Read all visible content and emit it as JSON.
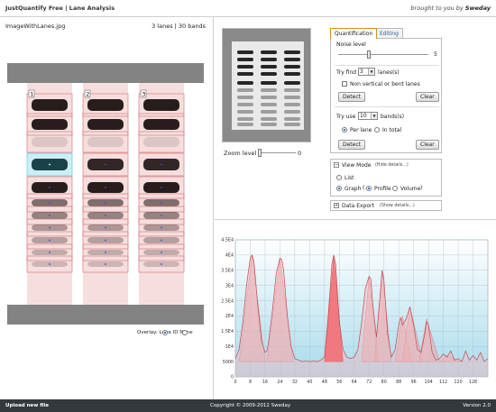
{
  "header": {
    "app_title": "JustQuantify Free  |  Lane Analysis",
    "brand_prefix": "brought to you by ",
    "brand_name": "Sweday"
  },
  "image_panel": {
    "file_name": "ImageWithLanes.jpg",
    "lane_count": "3 lanes | 30 bands",
    "lane_ids": [
      "1",
      "2",
      "3"
    ],
    "overlay": {
      "label": "Overlay:",
      "options": [
        {
          "label": "Lane ID",
          "selected": true
        },
        {
          "label": "None",
          "selected": false
        }
      ]
    }
  },
  "zoom": {
    "label": "Zoom level",
    "value": "0"
  },
  "tabs": [
    {
      "label": "Quantification",
      "active": true
    },
    {
      "label": "Editing",
      "active": false
    }
  ],
  "quant": {
    "noise_label": "Noise level",
    "noise_value": "5",
    "try_find_label": "Try find",
    "lanes_value": "3",
    "lanes_suffix": "lanes(s)",
    "non_vertical_label": "Non vertical or bent lanes",
    "detect_label": "Detect",
    "clear_label": "Clear",
    "try_use_label": "Try use",
    "bands_value": "10",
    "bands_suffix": "bands(s)",
    "per_lane_label": "Per lane",
    "in_total_label": "In total",
    "per_lane_selected": true
  },
  "view_mode": {
    "title": "View Mode",
    "hide_link": "(Hide details...)",
    "list_label": "List",
    "graph_label": "Graph",
    "profile_label": "Profile",
    "volume_label": "Volume",
    "graph_selected": true,
    "profile_selected": true
  },
  "data_export": {
    "title": "Data Export",
    "show_link": "(Show details...)"
  },
  "footer": {
    "upload_label": "Upload new file",
    "copyright": "Copyright © 2009-2012 Sweday",
    "version": "Version 2.0"
  },
  "chart_data": {
    "type": "area",
    "xlim": [
      0,
      136
    ],
    "ylim": [
      0,
      45000
    ],
    "y_ticks": [
      0,
      5000,
      10000,
      15000,
      20000,
      25000,
      30000,
      35000,
      40000,
      45000
    ],
    "y_tick_labels": [
      "0",
      "5000",
      "1E4",
      "1.5E4",
      "2E4",
      "2.5E4",
      "3E4",
      "3.5E4",
      "4E4",
      "4.5E4"
    ],
    "x_ticks": [
      0,
      8,
      16,
      24,
      32,
      40,
      48,
      56,
      64,
      72,
      80,
      88,
      96,
      104,
      112,
      120,
      128
    ],
    "x_tick_labels": [
      "0",
      "8",
      "16",
      "24",
      "32",
      "40",
      "48",
      "56",
      "64",
      "72",
      "80",
      "88",
      "96",
      "104",
      "112",
      "120",
      "128"
    ],
    "grid": true,
    "highlighted_peak_index": 2,
    "peaks": [
      {
        "x": [
          2,
          9,
          16
        ],
        "y": [
          5000,
          40000,
          5000
        ]
      },
      {
        "x": [
          17,
          24,
          31
        ],
        "y": [
          5000,
          39000,
          5000
        ]
      },
      {
        "x": [
          48,
          53,
          58
        ],
        "y": [
          5000,
          40000,
          5000
        ]
      },
      {
        "x": [
          68,
          72,
          77
        ],
        "y": [
          5000,
          33000,
          5000
        ]
      },
      {
        "x": [
          75,
          79,
          84
        ],
        "y": [
          5000,
          35000,
          5000
        ]
      },
      {
        "x": [
          86,
          90,
          95
        ],
        "y": [
          5000,
          20000,
          5000
        ]
      },
      {
        "x": [
          90,
          94,
          101
        ],
        "y": [
          5000,
          23000,
          5000
        ]
      },
      {
        "x": [
          99,
          103,
          110
        ],
        "y": [
          5000,
          19000,
          5000
        ]
      },
      {
        "x": [
          110,
          114,
          121
        ],
        "y": [
          5000,
          7000,
          5000
        ]
      }
    ],
    "series": [
      {
        "x": [
          0,
          2,
          4,
          6,
          8,
          9,
          10,
          12,
          14,
          16,
          17,
          18,
          20,
          22,
          24,
          25,
          26,
          28,
          30,
          32,
          34,
          36,
          38,
          40,
          42,
          44,
          46,
          48,
          50,
          52,
          53,
          54,
          56,
          58,
          60,
          62,
          64,
          66,
          68,
          70,
          72,
          73,
          74,
          76,
          78,
          79,
          80,
          82,
          84,
          86,
          88,
          89,
          90,
          92,
          94,
          96,
          98,
          100,
          102,
          103,
          104,
          106,
          108,
          110,
          112,
          114,
          116,
          118,
          120,
          122,
          124,
          126,
          128,
          130,
          132,
          134,
          136
        ],
        "y": [
          6000,
          9000,
          18000,
          30000,
          39000,
          40000,
          38000,
          24000,
          12000,
          8000,
          8500,
          12000,
          22000,
          34000,
          39000,
          38500,
          35000,
          20000,
          10000,
          6000,
          5500,
          5000,
          5200,
          5000,
          5200,
          5000,
          5500,
          6500,
          20000,
          37000,
          40000,
          37000,
          18000,
          9000,
          6500,
          6000,
          6500,
          9000,
          18000,
          29000,
          33000,
          32000,
          24000,
          13000,
          27000,
          35000,
          32000,
          14000,
          6500,
          9000,
          17000,
          19500,
          17000,
          19000,
          23000,
          17000,
          9000,
          8000,
          14000,
          18000,
          17000,
          8000,
          5500,
          6000,
          7500,
          6500,
          8500,
          5500,
          6000,
          5000,
          8500,
          5500,
          7000,
          5500,
          8000,
          5000,
          6000
        ]
      }
    ]
  }
}
